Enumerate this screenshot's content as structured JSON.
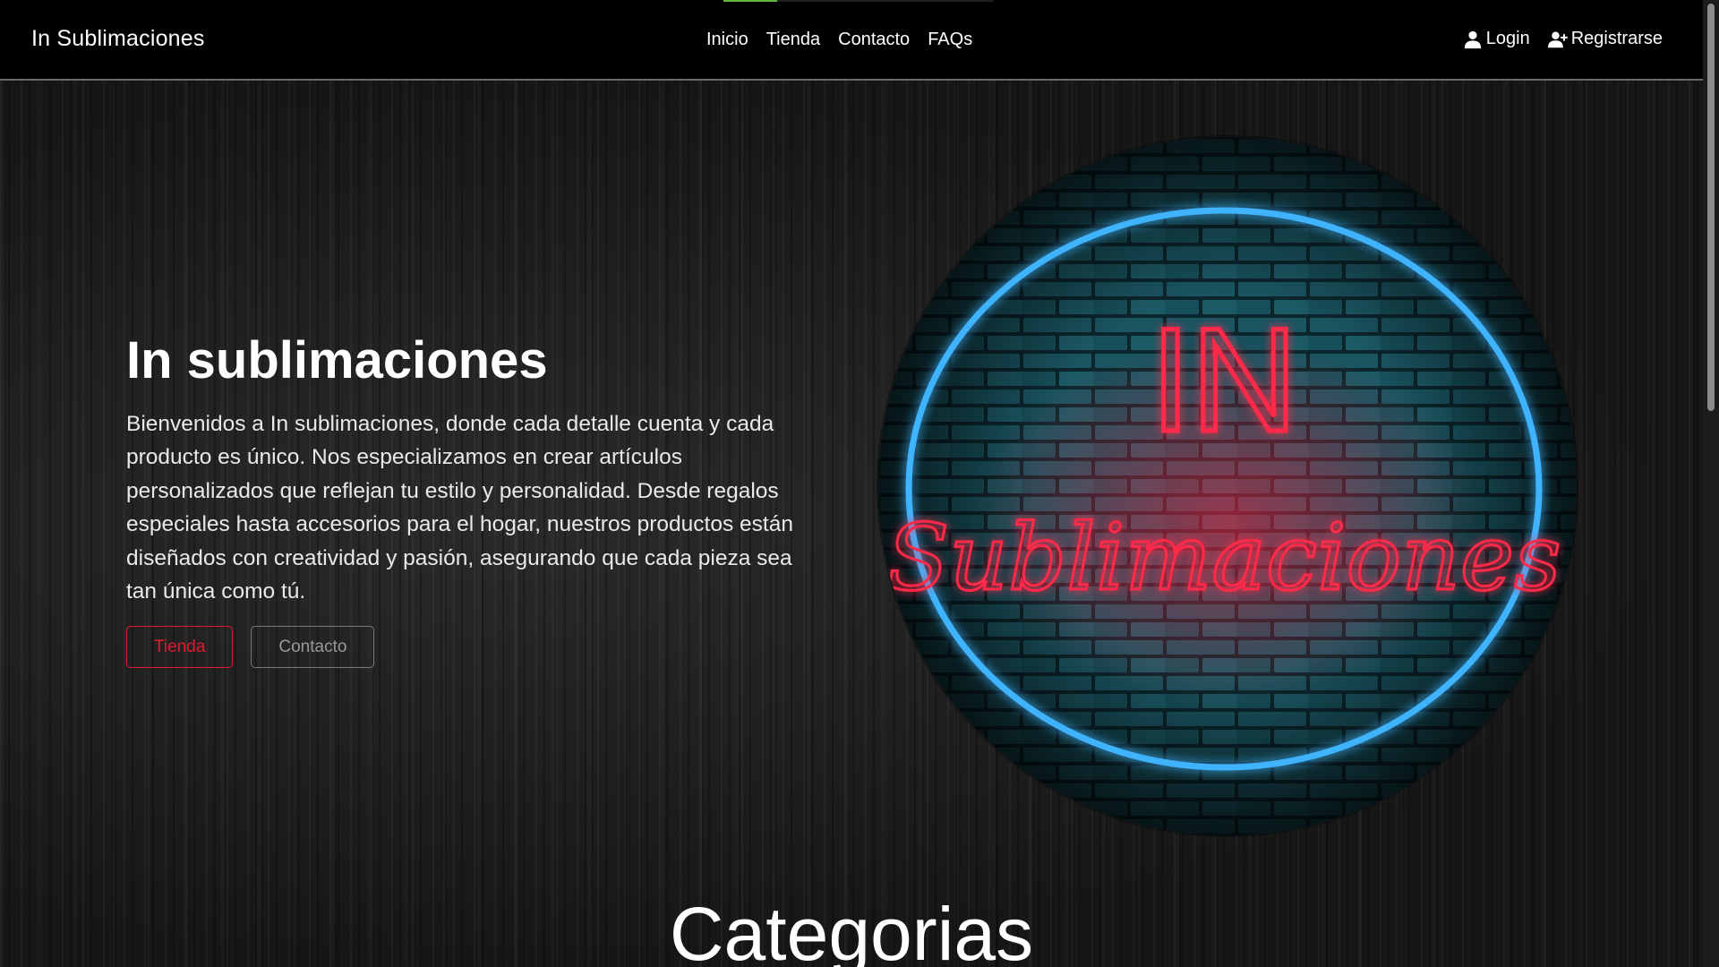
{
  "page_progress": 0.2,
  "nav": {
    "brand": "In Sublimaciones",
    "links": [
      "Inicio",
      "Tienda",
      "Contacto",
      "FAQs"
    ],
    "login_label": "Login",
    "register_label": "Registrarse"
  },
  "hero": {
    "title": "In sublimaciones",
    "description": "Bienvenidos a In sublimaciones, donde cada detalle cuenta y cada producto es único. Nos especializamos en crear artículos personalizados que reflejan tu estilo y personalidad. Desde regalos especiales hasta accesorios para el hogar, nuestros productos están diseñados con creatividad y pasión, asegurando que cada pieza sea tan única como tú.",
    "btn_tienda": "Tienda",
    "btn_contacto": "Contacto"
  },
  "logo": {
    "line1": "IN",
    "line2": "Sublimaciones",
    "ring_color": "#3fb3ff",
    "text_color": "#ff2a4a"
  },
  "section": {
    "title": "Categorias"
  },
  "colors": {
    "accent_red": "#e3192f",
    "navbar_bg": "#000000"
  }
}
